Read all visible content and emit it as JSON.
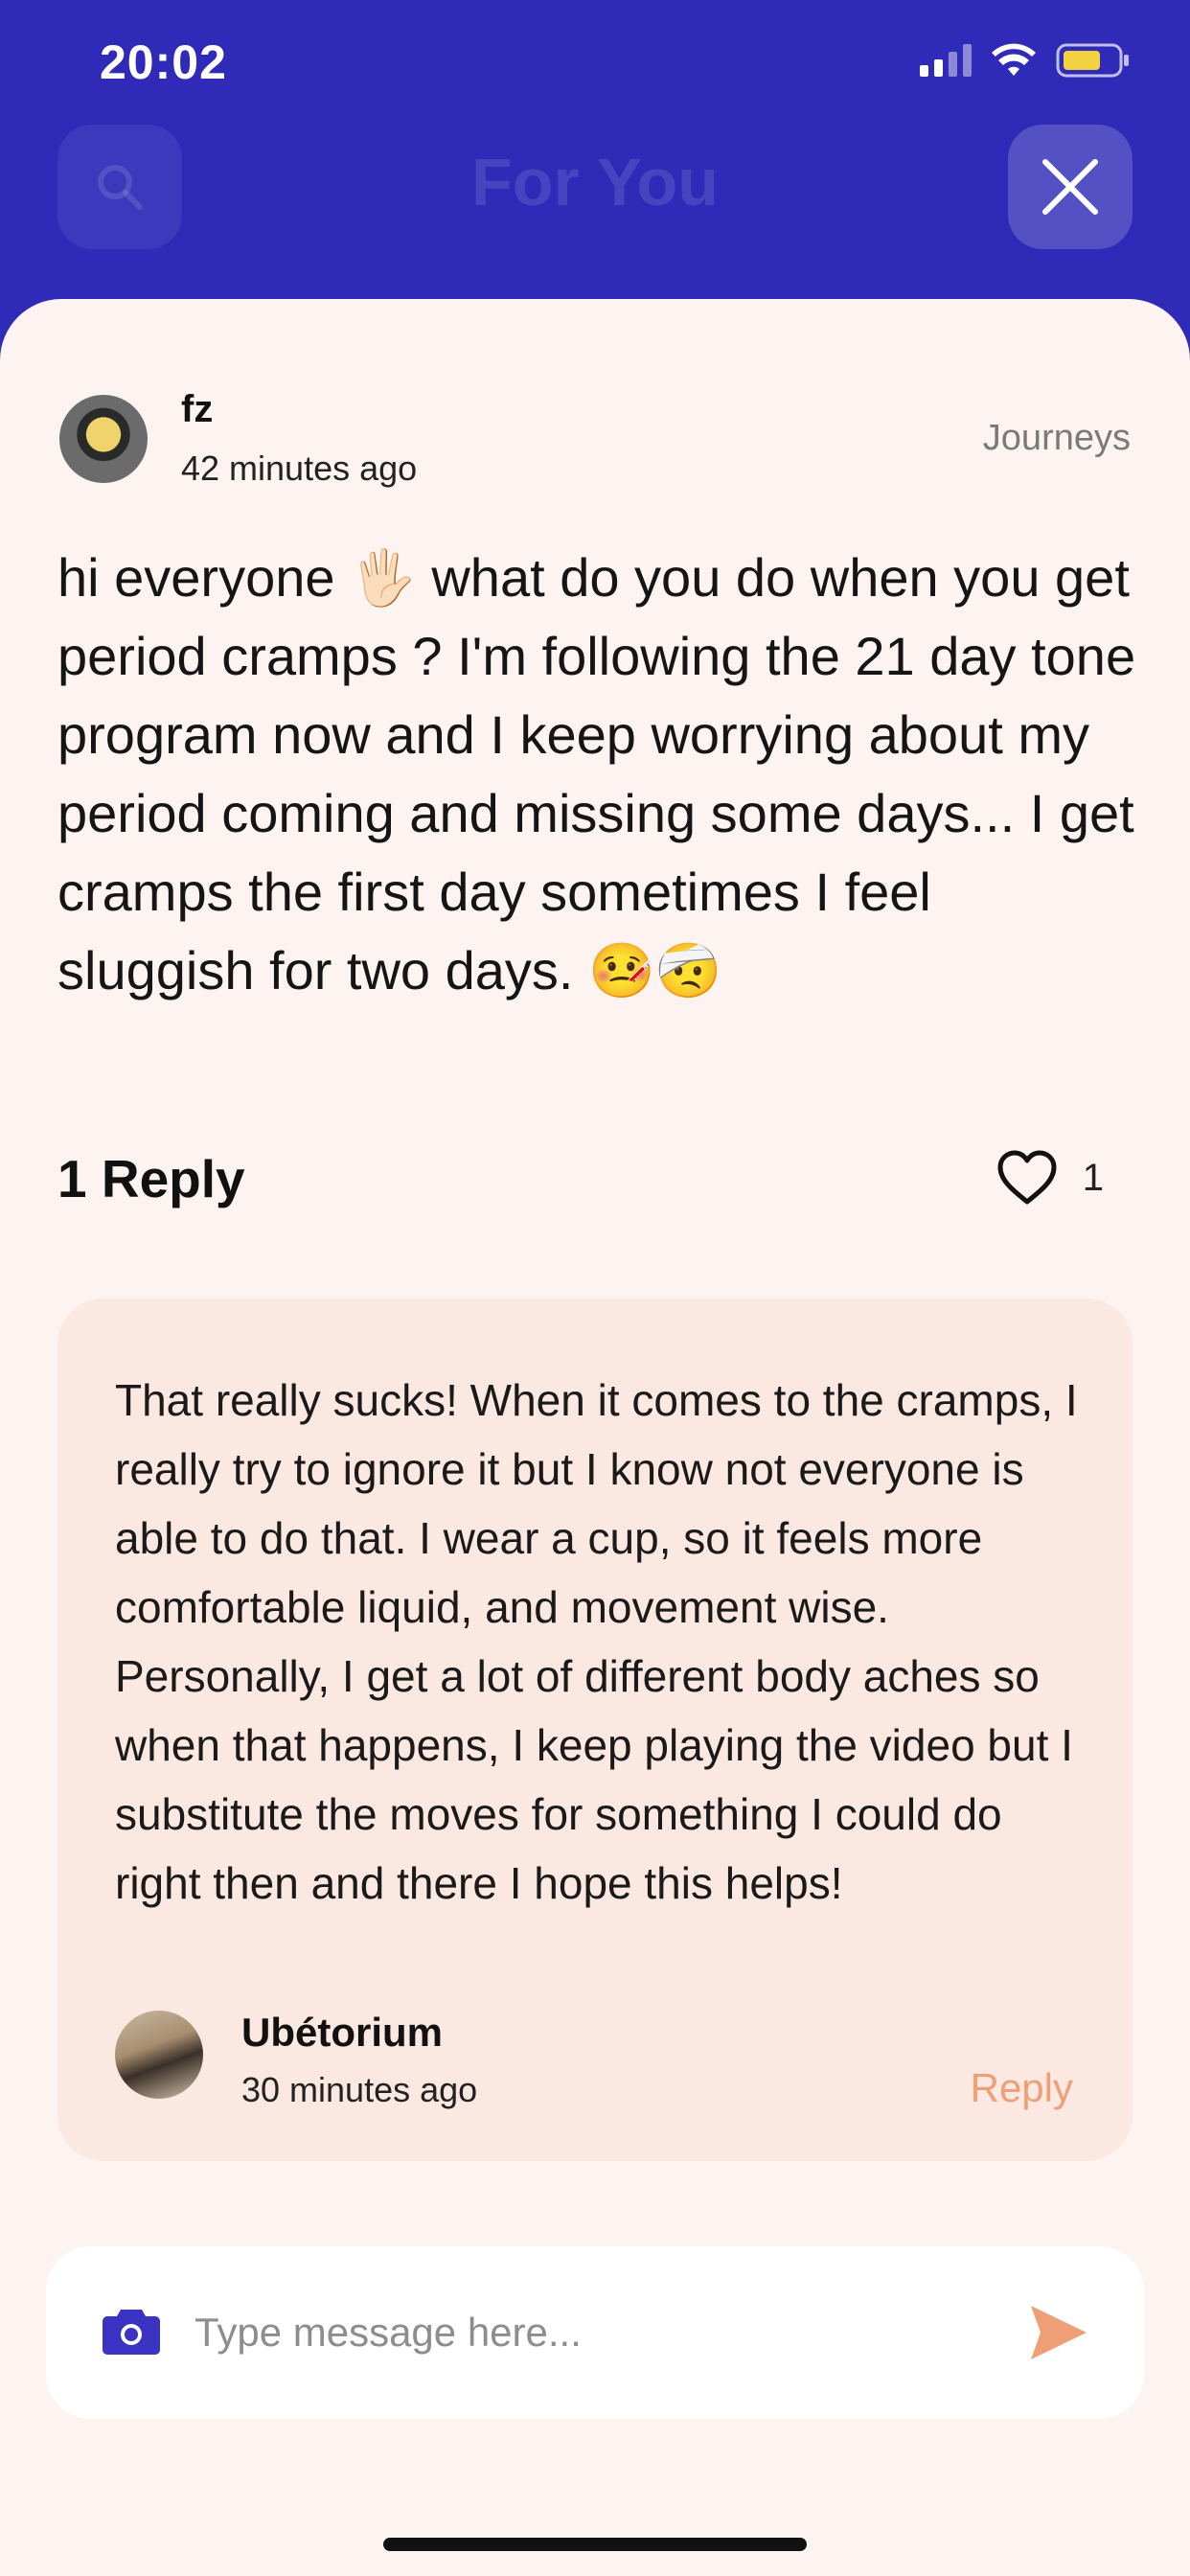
{
  "status_bar": {
    "time": "20:02"
  },
  "header": {
    "title": "For You"
  },
  "post": {
    "author": "fz",
    "time": "42 minutes ago",
    "category": "Journeys",
    "body": "hi everyone 🖐🏻 what do you do when you get period cramps ? I'm following the 21 day tone program now and I keep worrying about my period coming and missing some days... I get cramps the first day sometimes I feel sluggish for two days. 🤒🤕",
    "replies_label": "1 Reply",
    "likes": "1"
  },
  "reply": {
    "body": "That really sucks! When it comes to the cramps, I really try to ignore it but I know not everyone is able to do that. I wear a cup, so it feels more comfortable liquid, and movement wise. Personally, I get a lot of different body aches so when that happens, I keep playing the video but I substitute the moves for something I could do right then and there I hope this helps!",
    "author": "Ubétorium",
    "time": "30 minutes ago",
    "reply_label": "Reply"
  },
  "composer": {
    "placeholder": "Type message here..."
  },
  "colors": {
    "header_bg": "#2f2bb8",
    "sheet_bg": "#fdf3f0",
    "reply_bg": "#fbe8e1",
    "accent": "#ef9f78",
    "camera": "#3b33c4"
  }
}
